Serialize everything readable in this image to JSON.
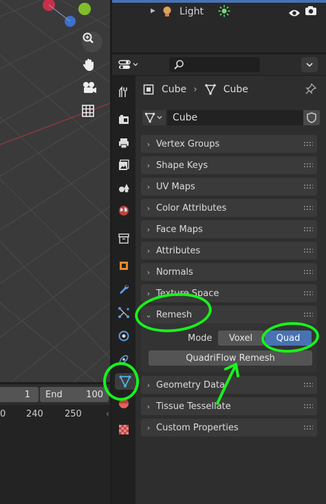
{
  "outliner": {
    "light_label": "Light"
  },
  "properties": {
    "breadcrumb": {
      "object": "Cube",
      "data": "Cube"
    },
    "mesh_name": "Cube",
    "panels_top": [
      {
        "label": "Vertex Groups"
      },
      {
        "label": "Shape Keys"
      },
      {
        "label": "UV Maps"
      },
      {
        "label": "Color Attributes"
      },
      {
        "label": "Face Maps"
      },
      {
        "label": "Attributes"
      },
      {
        "label": "Normals"
      },
      {
        "label": "Texture Space"
      }
    ],
    "remesh": {
      "label": "Remesh",
      "mode_label": "Mode",
      "voxel": "Voxel",
      "quad": "Quad",
      "quadriflow_button": "QuadriFlow Remesh"
    },
    "panels_bottom": [
      {
        "label": "Geometry Data"
      },
      {
        "label": "Tissue Tessellate"
      },
      {
        "label": "Custom Properties"
      }
    ]
  },
  "timeline": {
    "start_value": "1",
    "end_label": "End",
    "end_value": "100",
    "ruler": [
      "0",
      "240",
      "250"
    ]
  },
  "colors": {
    "accent_blue": "#4772b3",
    "annotation_green": "#18f21c",
    "panel_bg": "#2e2e2e"
  },
  "icons": [
    "zoom-icon",
    "hand-icon",
    "camera-icon",
    "grid-icon",
    "light-bulb-icon",
    "sun-icon",
    "eye-icon",
    "render-camera-icon",
    "editor-type-icon",
    "search-icon",
    "pin-icon",
    "mesh-data-icon",
    "shield-icon",
    "tool-icon",
    "render-icon",
    "output-icon",
    "view-layer-icon",
    "scene-icon",
    "world-icon",
    "collection-icon",
    "object-icon",
    "modifier-icon",
    "particles-icon",
    "physics-icon",
    "constraints-icon",
    "data-icon",
    "material-icon",
    "texture-icon"
  ]
}
